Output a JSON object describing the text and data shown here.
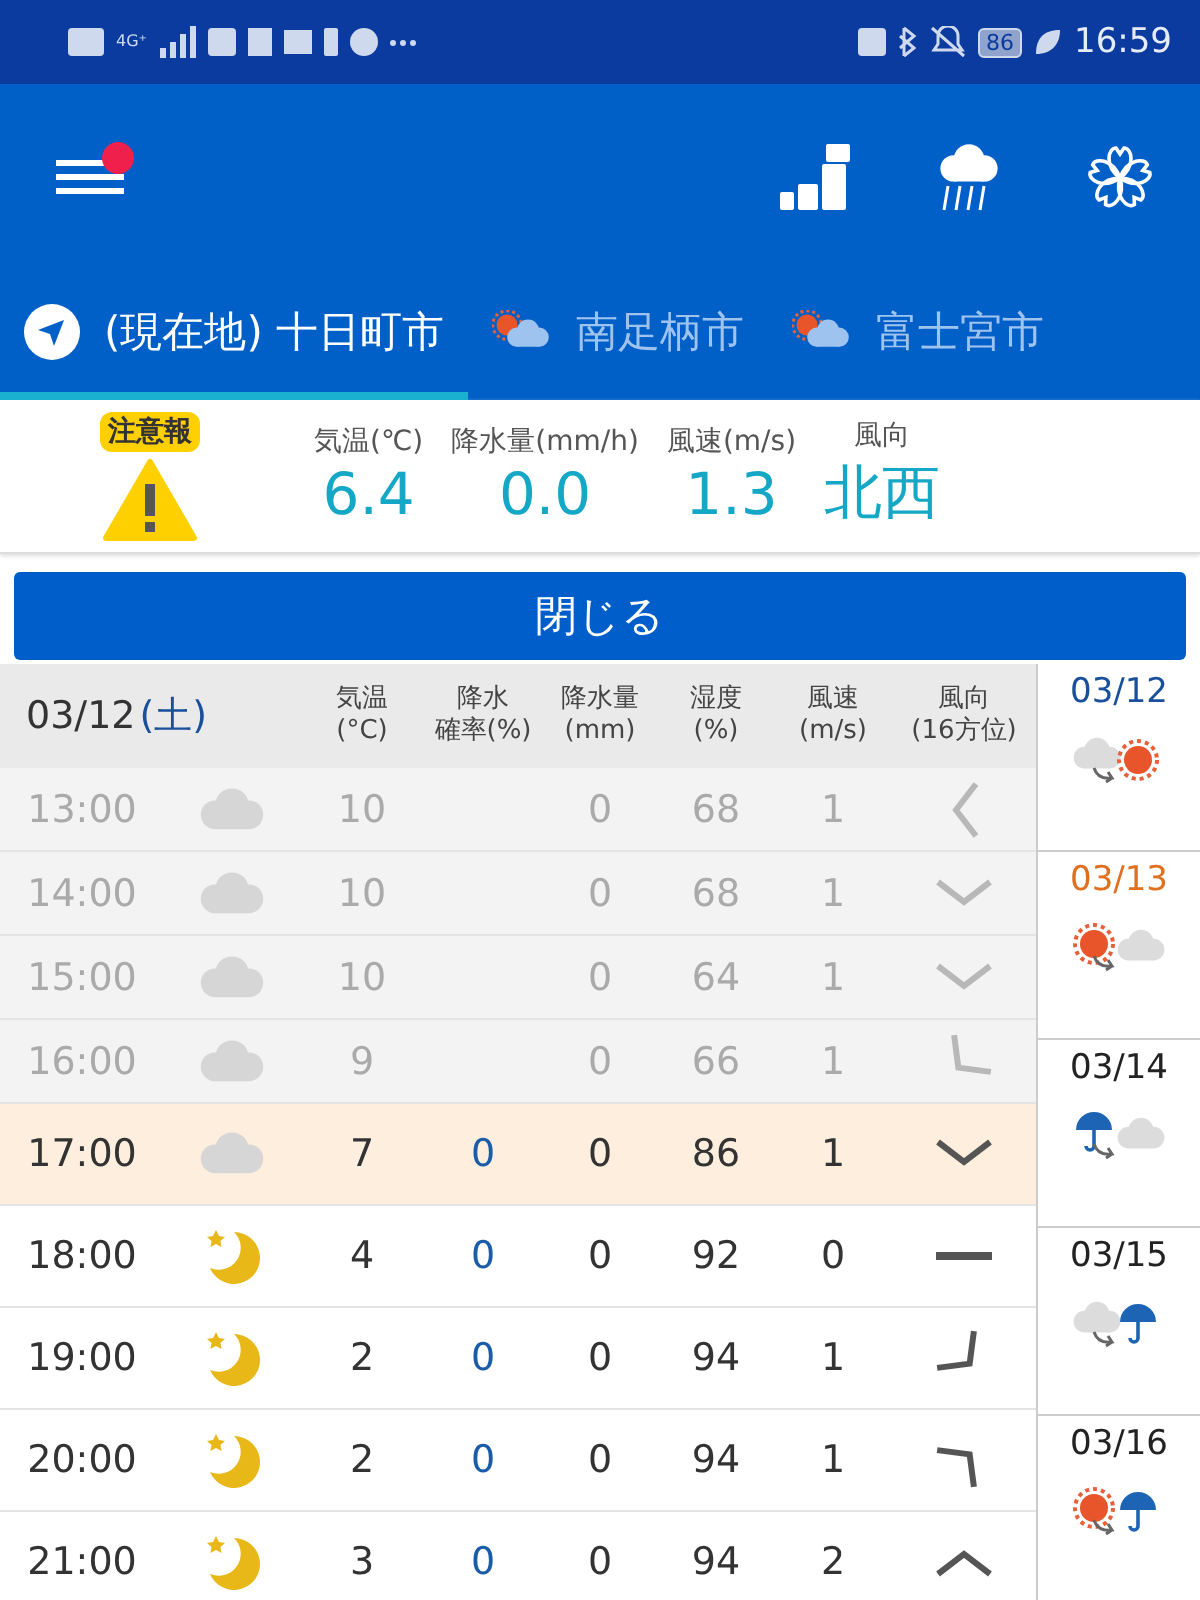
{
  "status_bar": {
    "network": "4G⁺",
    "battery": "86",
    "time": "16:59"
  },
  "app_bar": {
    "menu_badge": true
  },
  "tabs": [
    {
      "label": "(現在地) 十日町市",
      "kind": "location",
      "selected": true
    },
    {
      "label": "南足柄市",
      "kind": "weather",
      "selected": false
    },
    {
      "label": "富士宮市",
      "kind": "weather",
      "selected": false
    }
  ],
  "current": {
    "alert": "注意報",
    "metrics": [
      {
        "label": "気温(℃)",
        "value": "6.4"
      },
      {
        "label": "降水量(mm/h)",
        "value": "0.0"
      },
      {
        "label": "風速(m/s)",
        "value": "1.3"
      },
      {
        "label": "風向",
        "value": "北西"
      }
    ]
  },
  "close_button": "閉じる",
  "table": {
    "date": "03/12",
    "weekday": "(土)",
    "columns": [
      {
        "lines": [
          "気温",
          "(°C)"
        ]
      },
      {
        "lines": [
          "降水",
          "確率(%)"
        ]
      },
      {
        "lines": [
          "降水量",
          "(mm)"
        ]
      },
      {
        "lines": [
          "湿度",
          "(%)"
        ]
      },
      {
        "lines": [
          "風速",
          "(m/s)"
        ]
      },
      {
        "lines": [
          "風向",
          "(16方位)"
        ]
      }
    ],
    "rows": [
      {
        "time": "13:00",
        "weather": {
          "kind": "cloudy"
        },
        "temp": "10",
        "amount": "0",
        "humidity": "68",
        "wind": "1",
        "wind_dir": {
          "kind": "left"
        },
        "past": true,
        "selected": false
      },
      {
        "time": "14:00",
        "weather": {
          "kind": "cloudy"
        },
        "temp": "10",
        "amount": "0",
        "humidity": "68",
        "wind": "1",
        "wind_dir": {
          "kind": "down"
        },
        "past": true,
        "selected": false
      },
      {
        "time": "15:00",
        "weather": {
          "kind": "cloudy"
        },
        "temp": "10",
        "amount": "0",
        "humidity": "64",
        "wind": "1",
        "wind_dir": {
          "kind": "down"
        },
        "past": true,
        "selected": false
      },
      {
        "time": "16:00",
        "weather": {
          "kind": "cloudy"
        },
        "temp": "9",
        "amount": "0",
        "humidity": "66",
        "wind": "1",
        "wind_dir": {
          "kind": "downleft"
        },
        "past": true,
        "selected": false
      },
      {
        "time": "17:00",
        "weather": {
          "kind": "cloudy"
        },
        "temp": "7",
        "pop": "0",
        "amount": "0",
        "humidity": "86",
        "wind": "1",
        "wind_dir": {
          "kind": "down"
        },
        "past": false,
        "selected": true
      },
      {
        "time": "18:00",
        "weather": {
          "kind": "night"
        },
        "temp": "4",
        "pop": "0",
        "amount": "0",
        "humidity": "92",
        "wind": "0",
        "wind_dir": {
          "kind": "calm"
        },
        "past": false,
        "selected": false
      },
      {
        "time": "19:00",
        "weather": {
          "kind": "night"
        },
        "temp": "2",
        "pop": "0",
        "amount": "0",
        "humidity": "94",
        "wind": "1",
        "wind_dir": {
          "kind": "downright"
        },
        "past": false,
        "selected": false
      },
      {
        "time": "20:00",
        "weather": {
          "kind": "night"
        },
        "temp": "2",
        "pop": "0",
        "amount": "0",
        "humidity": "94",
        "wind": "1",
        "wind_dir": {
          "kind": "upright"
        },
        "past": false,
        "selected": false
      },
      {
        "time": "21:00",
        "weather": {
          "kind": "night"
        },
        "temp": "3",
        "pop": "0",
        "amount": "0",
        "humidity": "94",
        "wind": "2",
        "wind_dir": {
          "kind": "up"
        },
        "past": false,
        "selected": false
      }
    ]
  },
  "days": [
    {
      "date": "03/12",
      "color": "#1a4f9c",
      "from": {
        "kind": "cloud"
      },
      "to": {
        "kind": "sun"
      }
    },
    {
      "date": "03/13",
      "color": "#e07020",
      "from": {
        "kind": "sun"
      },
      "to": {
        "kind": "cloud"
      }
    },
    {
      "date": "03/14",
      "color": "#222222",
      "from": {
        "kind": "rain"
      },
      "to": {
        "kind": "cloud"
      }
    },
    {
      "date": "03/15",
      "color": "#222222",
      "from": {
        "kind": "cloud"
      },
      "to": {
        "kind": "rain"
      }
    },
    {
      "date": "03/16",
      "color": "#222222",
      "from": {
        "kind": "sun"
      },
      "to": {
        "kind": "rain"
      }
    }
  ]
}
